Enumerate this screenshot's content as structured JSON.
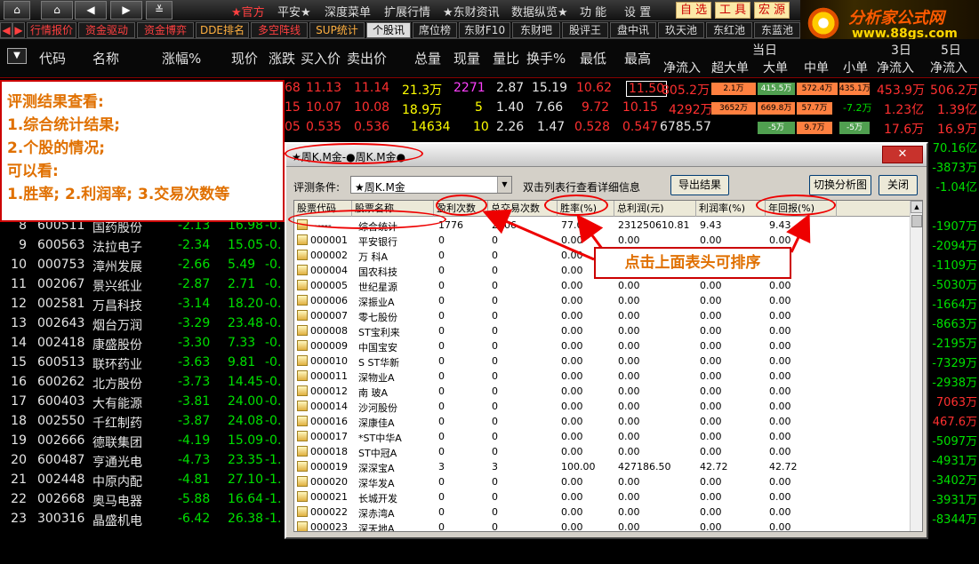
{
  "toolbar": {
    "menu": [
      "★官方",
      "平安★",
      "深度菜单",
      "扩展行情",
      "★东财资讯",
      "数据纵览★",
      "功 能",
      "设 置"
    ],
    "highlight": [
      "自 选",
      "工 具",
      "宏 源"
    ]
  },
  "logo": {
    "title": "分析家公式网",
    "url": "www.88gs.com"
  },
  "tabs": [
    "行情报价",
    "资金驱动",
    "资金博弈",
    "DDE排名",
    "多空阵线",
    "SUP统计",
    "个股讯",
    "席位榜",
    "东财F10",
    "东财吧",
    "股评王",
    "盘中讯",
    "玖天池",
    "东红池",
    "东蓝池"
  ],
  "header": {
    "cols": [
      "代码",
      "名称",
      "涨幅%",
      "现价",
      "涨跌",
      "买入价",
      "卖出价",
      "总量",
      "现量",
      "量比",
      "换手%",
      "最低",
      "最高",
      "净流入",
      "超大单",
      "大单",
      "中单",
      "小单",
      "净流入",
      "净流入"
    ],
    "group1": "当日",
    "group2": "3日",
    "group3": "5日"
  },
  "top_rows": [
    {
      "a": "68",
      "b": "11.13",
      "c": "11.14",
      "d": "21.3万",
      "e": "2271",
      "f": "2.87",
      "g": "15.19",
      "h": "10.62",
      "i": "11.50",
      "j": "805.2万",
      "k": "2.1万",
      "l": "415.5万",
      "m": "572.4万",
      "n": "435.1万",
      "o": "453.9万",
      "p": "506.2万"
    },
    {
      "a": "15",
      "b": "10.07",
      "c": "10.08",
      "d": "18.9万",
      "e": "5",
      "f": "1.40",
      "g": "7.66",
      "h": "9.72",
      "i": "10.15",
      "j": "4292万",
      "k": "3652万",
      "l": "669.8万",
      "m": "57.7万",
      "n": "-7.2万",
      "o": "1.23亿",
      "p": "1.39亿"
    },
    {
      "a": "05",
      "b": "0.535",
      "c": "0.536",
      "d": "14634",
      "e": "10",
      "f": "2.26",
      "g": "1.47",
      "h": "0.528",
      "i": "0.547",
      "j": "6785.57",
      "k": "",
      "l": "-5万",
      "m": "9.7万",
      "n": "-5万",
      "o": "17.6万",
      "p": "16.9万"
    }
  ],
  "stocks": [
    {
      "no": "8",
      "code": "600511",
      "name": "国药股份",
      "pct": "-2.13",
      "price": "16.98",
      "chg": "-0.",
      "net": "-1907万"
    },
    {
      "no": "9",
      "code": "600563",
      "name": "法拉电子",
      "pct": "-2.34",
      "price": "15.05",
      "chg": "-0.",
      "net": "-2094万"
    },
    {
      "no": "10",
      "code": "000753",
      "name": "漳州发展",
      "pct": "-2.66",
      "price": "5.49",
      "chg": "-0.",
      "net": "-1109万"
    },
    {
      "no": "11",
      "code": "002067",
      "name": "景兴纸业",
      "pct": "-2.87",
      "price": "2.71",
      "chg": "-0.",
      "net": "-5030万"
    },
    {
      "no": "12",
      "code": "002581",
      "name": "万昌科技",
      "pct": "-3.14",
      "price": "18.20",
      "chg": "-0.",
      "net": "-1664万"
    },
    {
      "no": "13",
      "code": "002643",
      "name": "烟台万润",
      "pct": "-3.29",
      "price": "23.48",
      "chg": "-0.",
      "net": "-8663万"
    },
    {
      "no": "14",
      "code": "002418",
      "name": "康盛股份",
      "pct": "-3.30",
      "price": "7.33",
      "chg": "-0.",
      "net": "-2195万"
    },
    {
      "no": "15",
      "code": "600513",
      "name": "联环药业",
      "pct": "-3.63",
      "price": "9.81",
      "chg": "-0.",
      "net": "-7329万"
    },
    {
      "no": "16",
      "code": "600262",
      "name": "北方股份",
      "pct": "-3.73",
      "price": "14.45",
      "chg": "-0.",
      "net": "-2938万"
    },
    {
      "no": "17",
      "code": "600403",
      "name": "大有能源",
      "pct": "-3.81",
      "price": "24.00",
      "chg": "-0.",
      "net": "7063万"
    },
    {
      "no": "18",
      "code": "002550",
      "name": "千红制药",
      "pct": "-3.87",
      "price": "24.08",
      "chg": "-0.",
      "net": "467.6万"
    },
    {
      "no": "19",
      "code": "002666",
      "name": "德联集团",
      "pct": "-4.19",
      "price": "15.09",
      "chg": "-0.",
      "net": "-5097万"
    },
    {
      "no": "20",
      "code": "600487",
      "name": "亨通光电",
      "pct": "-4.73",
      "price": "23.35",
      "chg": "-1.",
      "net": "-4931万"
    },
    {
      "no": "21",
      "code": "002448",
      "name": "中原内配",
      "pct": "-4.81",
      "price": "27.10",
      "chg": "-1.",
      "net": "-3402万"
    },
    {
      "no": "22",
      "code": "002668",
      "name": "奥马电器",
      "pct": "-5.88",
      "price": "16.64",
      "chg": "-1.",
      "net": "-3931万"
    },
    {
      "no": "23",
      "code": "300316",
      "name": "晶盛机电",
      "pct": "-6.42",
      "price": "26.38",
      "chg": "-1.",
      "net": "-8344万"
    }
  ],
  "right_extra": [
    "70.16亿",
    "-3873万",
    "-1.04亿"
  ],
  "callout": [
    "评测结果查看:",
    "1.综合统计结果;",
    "2.个股的情况;",
    "可以看:",
    "1.胜率; 2.利润率; 3.交易次数等"
  ],
  "dialog": {
    "title": "★周K.M金-●周K.M金●",
    "cond_label": "评测条件:",
    "cond_value": "★周K.M金",
    "hint": "双击列表行查看详细信息",
    "export": "导出结果",
    "switch": "切换分析图",
    "close": "关闭",
    "annotation": "点击上面表头可排序",
    "columns": [
      "股票代码",
      "股票名称",
      "盈利次数",
      "总交易次数",
      "胜率(%)",
      "总利润(元)",
      "利润率(%)",
      "年回报(%)"
    ],
    "rows": [
      [
        "------",
        "综合统计",
        "1776",
        "2306",
        "77.0",
        "231250610.81",
        "9.43",
        "9.43"
      ],
      [
        "000001",
        "平安银行",
        "0",
        "0",
        "0.00",
        "0.00",
        "0.00",
        "0.00"
      ],
      [
        "000002",
        "万 科A",
        "0",
        "0",
        "0.00",
        "0.00",
        "0.00",
        "0.00"
      ],
      [
        "000004",
        "国农科技",
        "0",
        "0",
        "0.00",
        "0.00",
        "0.00",
        "0.00"
      ],
      [
        "000005",
        "世纪星源",
        "0",
        "0",
        "0.00",
        "0.00",
        "0.00",
        "0.00"
      ],
      [
        "000006",
        "深振业A",
        "0",
        "0",
        "0.00",
        "0.00",
        "0.00",
        "0.00"
      ],
      [
        "000007",
        "零七股份",
        "0",
        "0",
        "0.00",
        "0.00",
        "0.00",
        "0.00"
      ],
      [
        "000008",
        "ST宝利来",
        "0",
        "0",
        "0.00",
        "0.00",
        "0.00",
        "0.00"
      ],
      [
        "000009",
        "中国宝安",
        "0",
        "0",
        "0.00",
        "0.00",
        "0.00",
        "0.00"
      ],
      [
        "000010",
        "S ST华新",
        "0",
        "0",
        "0.00",
        "0.00",
        "0.00",
        "0.00"
      ],
      [
        "000011",
        "深物业A",
        "0",
        "0",
        "0.00",
        "0.00",
        "0.00",
        "0.00"
      ],
      [
        "000012",
        "南 玻A",
        "0",
        "0",
        "0.00",
        "0.00",
        "0.00",
        "0.00"
      ],
      [
        "000014",
        "沙河股份",
        "0",
        "0",
        "0.00",
        "0.00",
        "0.00",
        "0.00"
      ],
      [
        "000016",
        "深康佳A",
        "0",
        "0",
        "0.00",
        "0.00",
        "0.00",
        "0.00"
      ],
      [
        "000017",
        "*ST中华A",
        "0",
        "0",
        "0.00",
        "0.00",
        "0.00",
        "0.00"
      ],
      [
        "000018",
        "ST中冠A",
        "0",
        "0",
        "0.00",
        "0.00",
        "0.00",
        "0.00"
      ],
      [
        "000019",
        "深深宝A",
        "3",
        "3",
        "100.00",
        "427186.50",
        "42.72",
        "42.72"
      ],
      [
        "000020",
        "深华发A",
        "0",
        "0",
        "0.00",
        "0.00",
        "0.00",
        "0.00"
      ],
      [
        "000021",
        "长城开发",
        "0",
        "0",
        "0.00",
        "0.00",
        "0.00",
        "0.00"
      ],
      [
        "000022",
        "深赤湾A",
        "0",
        "0",
        "0.00",
        "0.00",
        "0.00",
        "0.00"
      ],
      [
        "000023",
        "深天地A",
        "0",
        "0",
        "0.00",
        "0.00",
        "0.00",
        "0.00"
      ]
    ]
  }
}
